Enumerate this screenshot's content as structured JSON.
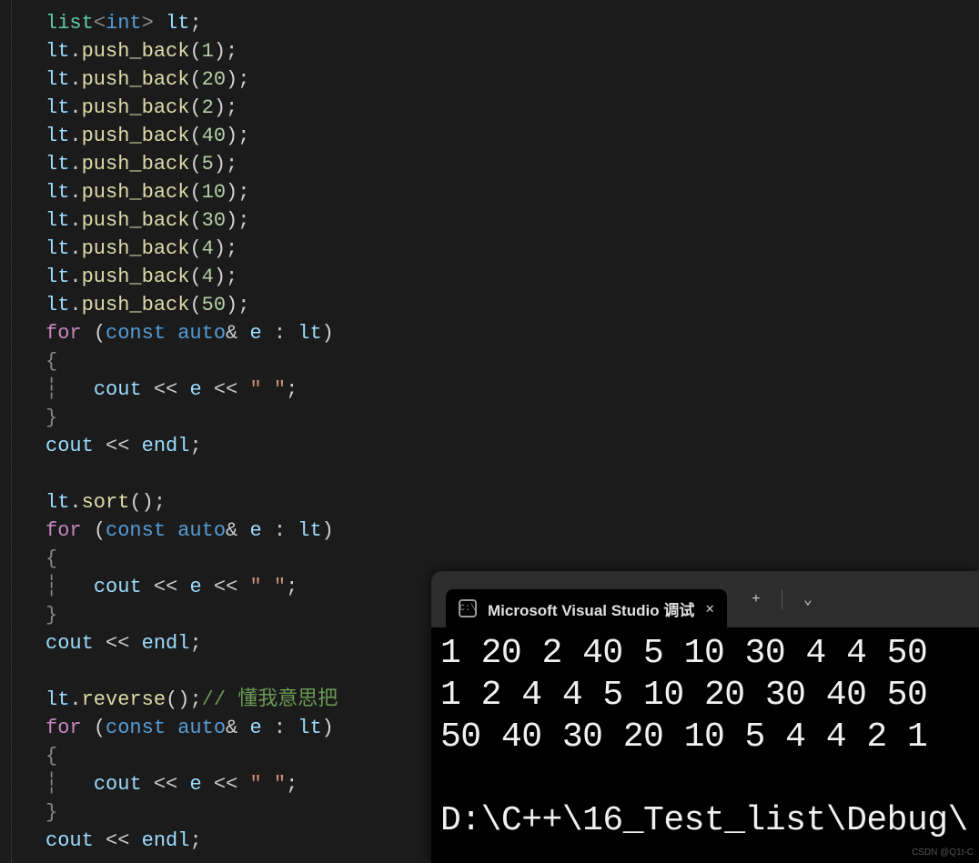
{
  "code": {
    "lines": [
      {
        "html": "<span style='color:#5ccca8'>list</span><span style='color:#888'>&lt;</span><span style='color:#569cd6'>int</span><span style='color:#888'>&gt;</span> <span style='color:#9cdcfe'>lt</span><span style='color:#ccc'>;</span>"
      },
      {
        "html": "<span style='color:#9cdcfe'>lt</span><span style='color:#ccc'>.</span><span style='color:#dcdcaa'>push_back</span><span style='color:#d4d4d4'>(</span><span style='color:#b5cea8'>1</span><span style='color:#d4d4d4'>)</span><span style='color:#ccc'>;</span>"
      },
      {
        "html": "<span style='color:#9cdcfe'>lt</span><span style='color:#ccc'>.</span><span style='color:#dcdcaa'>push_back</span><span style='color:#d4d4d4'>(</span><span style='color:#b5cea8'>20</span><span style='color:#d4d4d4'>)</span><span style='color:#ccc'>;</span>"
      },
      {
        "html": "<span style='color:#9cdcfe'>lt</span><span style='color:#ccc'>.</span><span style='color:#dcdcaa'>push_back</span><span style='color:#d4d4d4'>(</span><span style='color:#b5cea8'>2</span><span style='color:#d4d4d4'>)</span><span style='color:#ccc'>;</span>"
      },
      {
        "html": "<span style='color:#9cdcfe'>lt</span><span style='color:#ccc'>.</span><span style='color:#dcdcaa'>push_back</span><span style='color:#d4d4d4'>(</span><span style='color:#b5cea8'>40</span><span style='color:#d4d4d4'>)</span><span style='color:#ccc'>;</span>"
      },
      {
        "html": "<span style='color:#9cdcfe'>lt</span><span style='color:#ccc'>.</span><span style='color:#dcdcaa'>push_back</span><span style='color:#d4d4d4'>(</span><span style='color:#b5cea8'>5</span><span style='color:#d4d4d4'>)</span><span style='color:#ccc'>;</span>"
      },
      {
        "html": "<span style='color:#9cdcfe'>lt</span><span style='color:#ccc'>.</span><span style='color:#dcdcaa'>push_back</span><span style='color:#d4d4d4'>(</span><span style='color:#b5cea8'>10</span><span style='color:#d4d4d4'>)</span><span style='color:#ccc'>;</span>"
      },
      {
        "html": "<span style='color:#9cdcfe'>lt</span><span style='color:#ccc'>.</span><span style='color:#dcdcaa'>push_back</span><span style='color:#d4d4d4'>(</span><span style='color:#b5cea8'>30</span><span style='color:#d4d4d4'>)</span><span style='color:#ccc'>;</span>"
      },
      {
        "html": "<span style='color:#9cdcfe'>lt</span><span style='color:#ccc'>.</span><span style='color:#dcdcaa'>push_back</span><span style='color:#d4d4d4'>(</span><span style='color:#b5cea8'>4</span><span style='color:#d4d4d4'>)</span><span style='color:#ccc'>;</span>"
      },
      {
        "html": "<span style='color:#9cdcfe'>lt</span><span style='color:#ccc'>.</span><span style='color:#dcdcaa'>push_back</span><span style='color:#d4d4d4'>(</span><span style='color:#b5cea8'>4</span><span style='color:#d4d4d4'>)</span><span style='color:#ccc'>;</span>"
      },
      {
        "html": "<span style='color:#9cdcfe'>lt</span><span style='color:#ccc'>.</span><span style='color:#dcdcaa'>push_back</span><span style='color:#d4d4d4'>(</span><span style='color:#b5cea8'>50</span><span style='color:#d4d4d4'>)</span><span style='color:#ccc'>;</span>"
      },
      {
        "html": "<span style='color:#c586c0'>for</span> <span style='color:#d4d4d4'>(</span><span style='color:#569cd6'>const</span> <span style='color:#569cd6'>auto</span><span style='color:#ccc'>&amp;</span> <span style='color:#9cdcfe'>e</span> <span style='color:#ccc'>:</span> <span style='color:#9cdcfe'>lt</span><span style='color:#d4d4d4'>)</span>"
      },
      {
        "html": "<span style='color:#888'>{</span>"
      },
      {
        "html": "<span style='color:#888'>&#x2506;</span>   <span style='color:#9cdcfe'>cout</span> <span style='color:#ccc'>&lt;&lt;</span> <span style='color:#9cdcfe'>e</span> <span style='color:#ccc'>&lt;&lt;</span> <span style='color:#ce9178'>&quot; &quot;</span><span style='color:#ccc'>;</span>"
      },
      {
        "html": "<span style='color:#888'>}</span>"
      },
      {
        "html": "<span style='color:#9cdcfe'>cout</span> <span style='color:#ccc'>&lt;&lt;</span> <span style='color:#9cdcfe'>endl</span><span style='color:#ccc'>;</span>"
      },
      {
        "html": " "
      },
      {
        "html": "<span style='color:#9cdcfe'>lt</span><span style='color:#ccc'>.</span><span style='color:#dcdcaa'>sort</span><span style='color:#d4d4d4'>()</span><span style='color:#ccc'>;</span>"
      },
      {
        "html": "<span style='color:#c586c0'>for</span> <span style='color:#d4d4d4'>(</span><span style='color:#569cd6'>const</span> <span style='color:#569cd6'>auto</span><span style='color:#ccc'>&amp;</span> <span style='color:#9cdcfe'>e</span> <span style='color:#ccc'>:</span> <span style='color:#9cdcfe'>lt</span><span style='color:#d4d4d4'>)</span>"
      },
      {
        "html": "<span style='color:#888'>{</span>"
      },
      {
        "html": "<span style='color:#888'>&#x2506;</span>   <span style='color:#9cdcfe'>cout</span> <span style='color:#ccc'>&lt;&lt;</span> <span style='color:#9cdcfe'>e</span> <span style='color:#ccc'>&lt;&lt;</span> <span style='color:#ce9178'>&quot; &quot;</span><span style='color:#ccc'>;</span>"
      },
      {
        "html": "<span style='color:#888'>}</span>"
      },
      {
        "html": "<span style='color:#9cdcfe'>cout</span> <span style='color:#ccc'>&lt;&lt;</span> <span style='color:#9cdcfe'>endl</span><span style='color:#ccc'>;</span>"
      },
      {
        "html": " "
      },
      {
        "html": "<span style='color:#9cdcfe'>lt</span><span style='color:#ccc'>.</span><span style='color:#dcdcaa'>reverse</span><span style='color:#d4d4d4'>()</span><span style='color:#ccc'>;</span><span style='color:#6a9955'>// 懂我意思把</span>"
      },
      {
        "html": "<span style='color:#c586c0'>for</span> <span style='color:#d4d4d4'>(</span><span style='color:#569cd6'>const</span> <span style='color:#569cd6'>auto</span><span style='color:#ccc'>&amp;</span> <span style='color:#9cdcfe'>e</span> <span style='color:#ccc'>:</span> <span style='color:#9cdcfe'>lt</span><span style='color:#d4d4d4'>)</span>"
      },
      {
        "html": "<span style='color:#888'>{</span>"
      },
      {
        "html": "<span style='color:#888'>&#x2506;</span>   <span style='color:#9cdcfe'>cout</span> <span style='color:#ccc'>&lt;&lt;</span> <span style='color:#9cdcfe'>e</span> <span style='color:#ccc'>&lt;&lt;</span> <span style='color:#ce9178'>&quot; &quot;</span><span style='color:#ccc'>;</span>"
      },
      {
        "html": "<span style='color:#888'>}</span>"
      },
      {
        "html": "<span style='color:#9cdcfe'>cout</span> <span style='color:#ccc'>&lt;&lt;</span> <span style='color:#9cdcfe'>endl</span><span style='color:#ccc'>;</span>"
      }
    ]
  },
  "terminal": {
    "tab_title": "Microsoft Visual Studio 调试",
    "tab_icon_text": "C:\\",
    "new_tab": "+",
    "dropdown": "⌄",
    "output": [
      "1 20 2 40 5 10 30 4 4 50",
      "1 2 4 4 5 10 20 30 40 50",
      "50 40 30 20 10 5 4 4 2 1",
      "",
      "D:\\C++\\16_Test_list\\Debug\\"
    ]
  },
  "watermark": "CSDN @Q1t-C"
}
